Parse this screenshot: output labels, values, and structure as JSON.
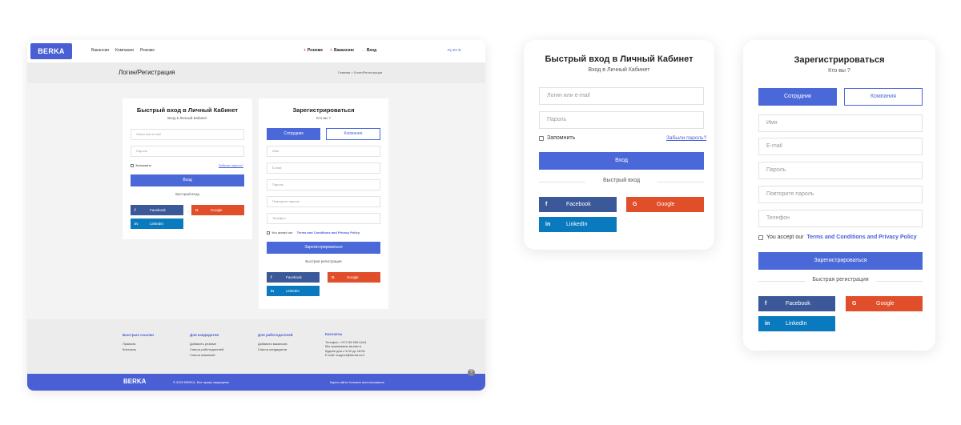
{
  "mock": {
    "logo": "BERKA",
    "nav": [
      "Вакансии",
      "Компании",
      "Резюме"
    ],
    "actions": [
      {
        "symbol": "+",
        "label": "Резюме"
      },
      {
        "symbol": "+",
        "label": "Вакансию"
      },
      {
        "symbol": "→",
        "label": "Вход"
      }
    ],
    "lang": "Ру  En  ℵ",
    "banner_title": "Логин/Регистрация",
    "breadcrumb": "Главная  >  Логин/Регистрация",
    "login": {
      "title": "Быстрый вход в Личный Кабинет",
      "subtitle": "Вход в Личный Кабинет",
      "login_placeholder": "Логин или e-mail",
      "password_placeholder": "Пароль",
      "remember": "Запомнить",
      "forgot": "Забыли пароль?",
      "submit": "Вход",
      "quick": "Быстрый вход"
    },
    "register": {
      "title": "Зарегистрироваться",
      "subtitle": "Кто вы ?",
      "employee": "Сотрудник",
      "company": "Компания",
      "name": "Имя",
      "email": "E-mail",
      "password": "Пароль",
      "repeat": "Повторите пароль",
      "phone": "Телефон",
      "accept_prefix": "You accept our",
      "accept_link": "Terms and Conditions and Privacy Policy",
      "submit": "Зарегистрироваться",
      "quick": "Быстрая регистрация"
    },
    "social": {
      "facebook": "Facebook",
      "google": "Google",
      "linkedin": "LinkedIn",
      "fb_icon": "f",
      "go_icon": "G",
      "li_icon": "in"
    },
    "footer": {
      "cols": [
        {
          "title": "Быстрые ссылки",
          "items": [
            "Правила",
            "Контакты"
          ]
        },
        {
          "title": "Для кандидатов",
          "items": [
            "Добавить резюме",
            "Список работодателей",
            "Список вакансий"
          ]
        },
        {
          "title": "Для работодателей",
          "items": [
            "Добавить вакансию",
            "Список кандидатов"
          ]
        },
        {
          "title": "Контакты",
          "items": [
            "Телефон: +972 55 555 4444",
            "Мы принимаем звонки в",
            "будние дни с 9:00 до 18:00",
            "E-mail: support@berka.co.il"
          ]
        }
      ],
      "logo": "BERKA",
      "copyright": "© 2020 BERKA. Все права защищены",
      "links": "Карта сайта    Условия использования",
      "help": "?"
    }
  },
  "login_card": {
    "title": "Быстрый вход в Личный Кабинет",
    "subtitle": "Вход в Личный Кабинет",
    "login_placeholder": "Логин или e-mail",
    "password_placeholder": "Пароль",
    "remember": "Запомнить",
    "forgot": "Забыли пароль?",
    "submit": "Вход",
    "quick": "Быстрый вход",
    "facebook": "Facebook",
    "google": "Google",
    "linkedin": "LinkedIn"
  },
  "register_card": {
    "title": "Зарегистрироваться",
    "subtitle": "Кто вы ?",
    "employee": "Сотрудник",
    "company": "Компания",
    "name": "Имя",
    "email": "E-mail",
    "password": "Пароль",
    "repeat": "Повторите пароль",
    "phone": "Телефон",
    "accept_prefix": "You accept our",
    "accept_link": "Terms and Conditions and Privacy Policy",
    "submit": "Зарегистрироваться",
    "quick": "Быстрая регистрация",
    "facebook": "Facebook",
    "google": "Google",
    "linkedin": "LinkedIn"
  },
  "colors": {
    "brand": "#4a5fd4",
    "button": "#4a68d8",
    "facebook": "#3b5998",
    "google": "#e04e2a",
    "linkedin": "#0a7abf"
  }
}
